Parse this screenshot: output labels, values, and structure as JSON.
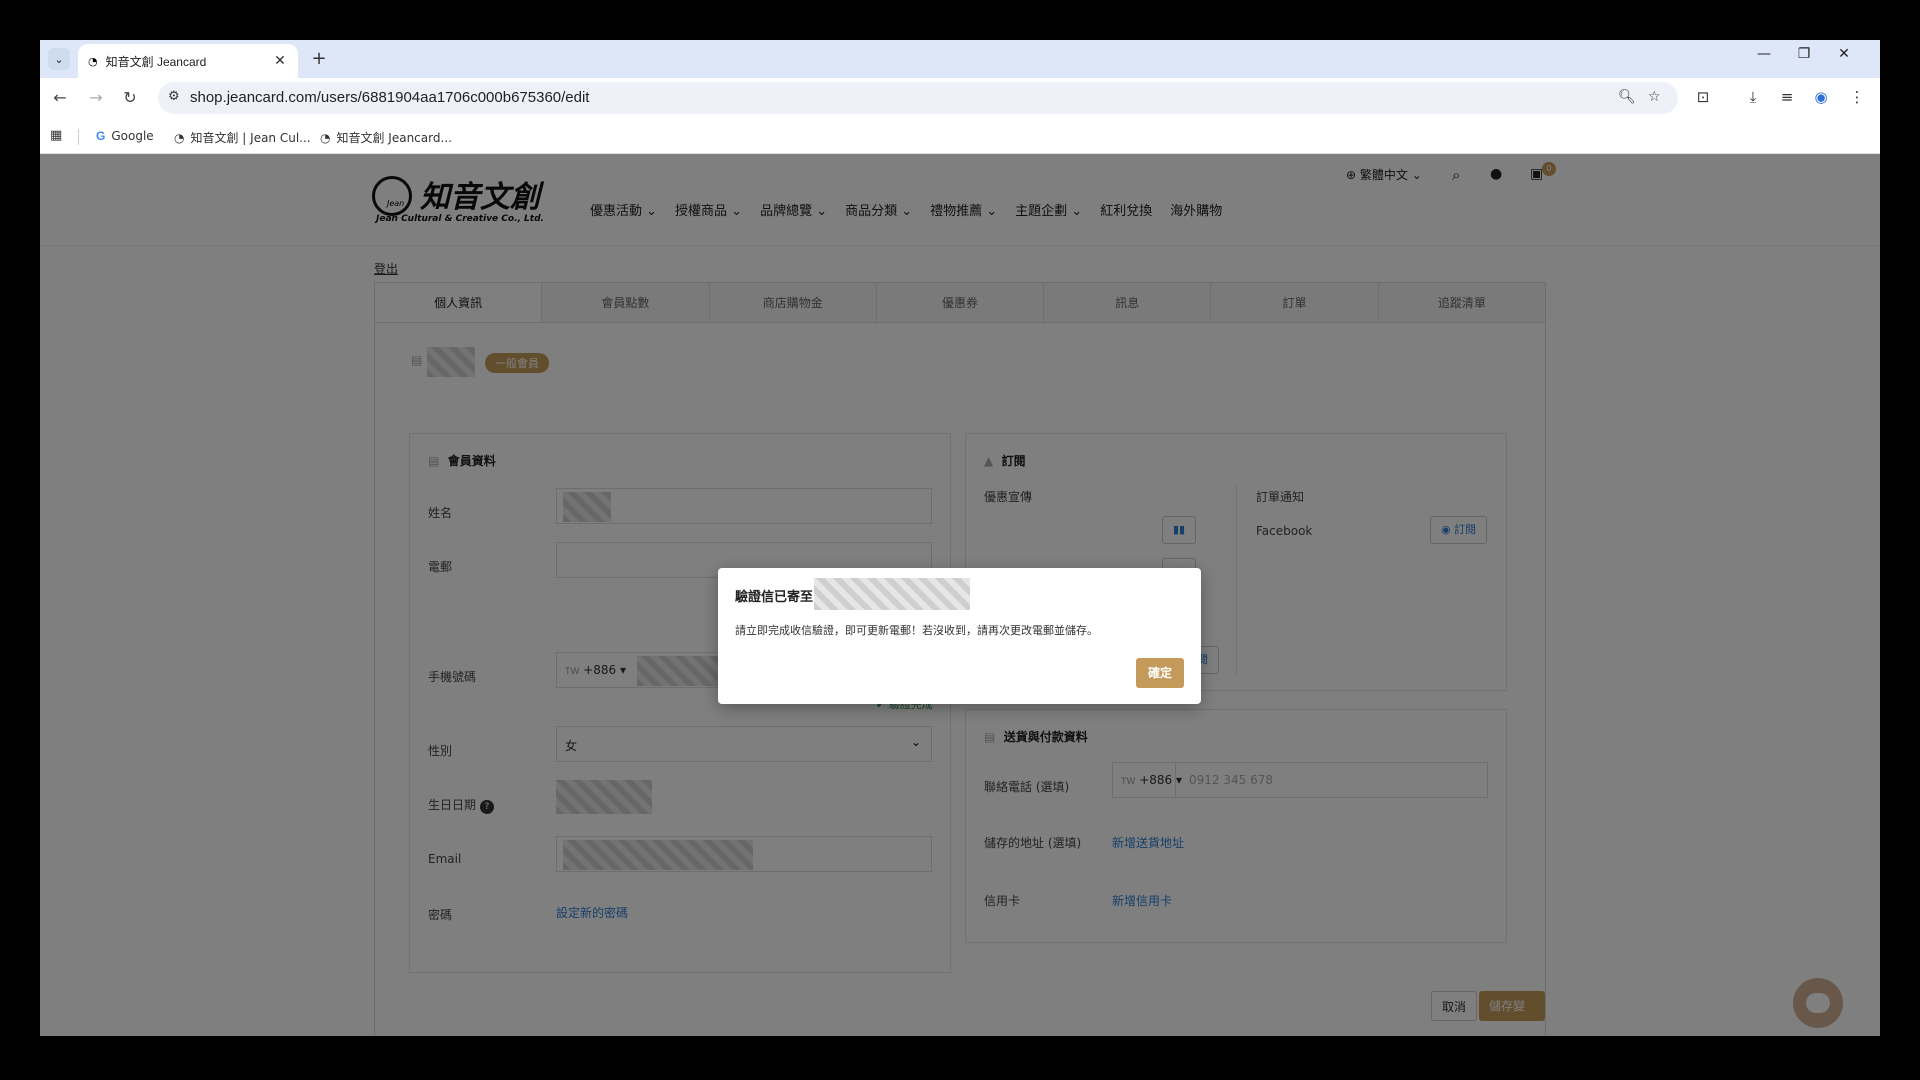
{
  "browser": {
    "tab_title": "知音文創 Jeancard",
    "url": "shop.jeancard.com/users/6881904aa1706c000b675360/edit",
    "bookmarks": [
      "Google",
      "知音文創 | Jean Cul...",
      "知音文創 Jeancard..."
    ]
  },
  "header": {
    "logo_text": "知音文創",
    "logo_sub": "Jean Cultural & Creative Co., Ltd.",
    "logo_mark": "Jean",
    "nav": [
      "優惠活動 ⌄",
      "授權商品 ⌄",
      "品牌總覽 ⌄",
      "商品分類 ⌄",
      "禮物推薦 ⌄",
      "主題企劃 ⌄",
      "紅利兌換",
      "海外購物"
    ],
    "language": "繁體中文",
    "cart_count": "0"
  },
  "account": {
    "logout": "登出",
    "tabs": [
      "個人資訊",
      "會員點數",
      "商店購物金",
      "優惠券",
      "訊息",
      "訂單",
      "追蹤清單"
    ],
    "member_badge": "一般會員"
  },
  "member_info": {
    "title": "會員資料",
    "name_label": "姓名",
    "email_edit_label": "電郵",
    "phone_label": "手機號碼",
    "phone_code_prefix": "TW",
    "phone_code": "+886",
    "verified": "驗證完成",
    "gender_label": "性別",
    "gender_value": "女",
    "birthday_label": "生日日期",
    "email_label": "Email",
    "password_label": "密碼",
    "password_link": "設定新的密碼"
  },
  "subscription": {
    "title": "訂閱",
    "promo_label": "優惠宣傳",
    "order_label": "訂單通知",
    "facebook": "Facebook",
    "subscribe": "訂閱"
  },
  "delivery": {
    "title": "送貨與付款資料",
    "contact_label": "聯絡電話 (選填)",
    "contact_code_prefix": "TW",
    "contact_code": "+886",
    "contact_placeholder": "0912 345 678",
    "address_label": "儲存的地址 (選填)",
    "address_link": "新增送貨地址",
    "card_label": "信用卡",
    "card_link": "新增信用卡"
  },
  "actions": {
    "cancel": "取消",
    "save": "儲存變更"
  },
  "modal": {
    "title": "驗證信已寄至",
    "body": "請立即完成收信驗證，即可更新電郵！若沒收到，請再次更改電郵並儲存。",
    "ok": "確定"
  }
}
